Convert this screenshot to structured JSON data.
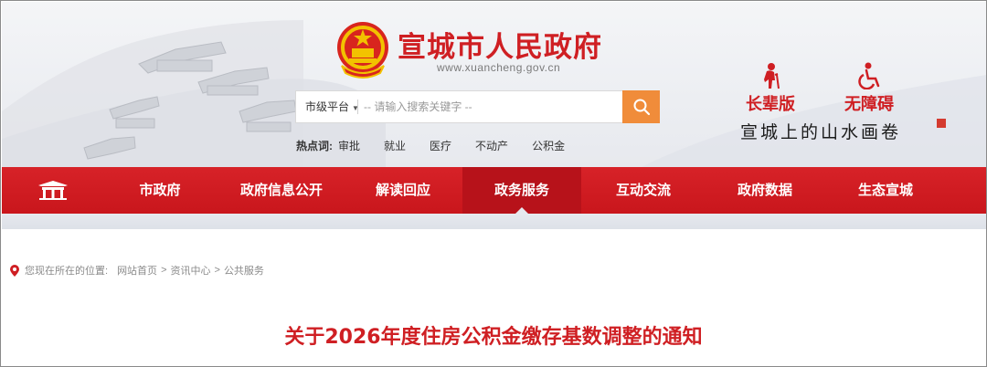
{
  "site": {
    "title": "宣城市人民政府",
    "url": "www.xuancheng.gov.cn"
  },
  "search": {
    "scope": "市级平台",
    "placeholder": "-- 请输入搜索关键字 --"
  },
  "hot": {
    "label": "热点词:",
    "items": [
      "审批",
      "就业",
      "医疗",
      "不动产",
      "公积金"
    ]
  },
  "access": {
    "elder": "长辈版",
    "barrier_free": "无障碍"
  },
  "slogan": "宣城上的山水画卷",
  "nav": {
    "items": [
      "市政府",
      "政府信息公开",
      "解读回应",
      "政务服务",
      "互动交流",
      "政府数据",
      "生态宣城"
    ],
    "active": "政务服务"
  },
  "breadcrumb": {
    "here": "您现在所在的位置:",
    "items": [
      "网站首页",
      "资讯中心",
      "公共服务"
    ],
    "separator": ">"
  },
  "article": {
    "title": "关于2026年度住房公积金缴存基数调整的通知"
  },
  "colors": {
    "brand_red": "#cf1f23",
    "nav_red": "#d72228",
    "search_orange": "#f08c3a"
  }
}
